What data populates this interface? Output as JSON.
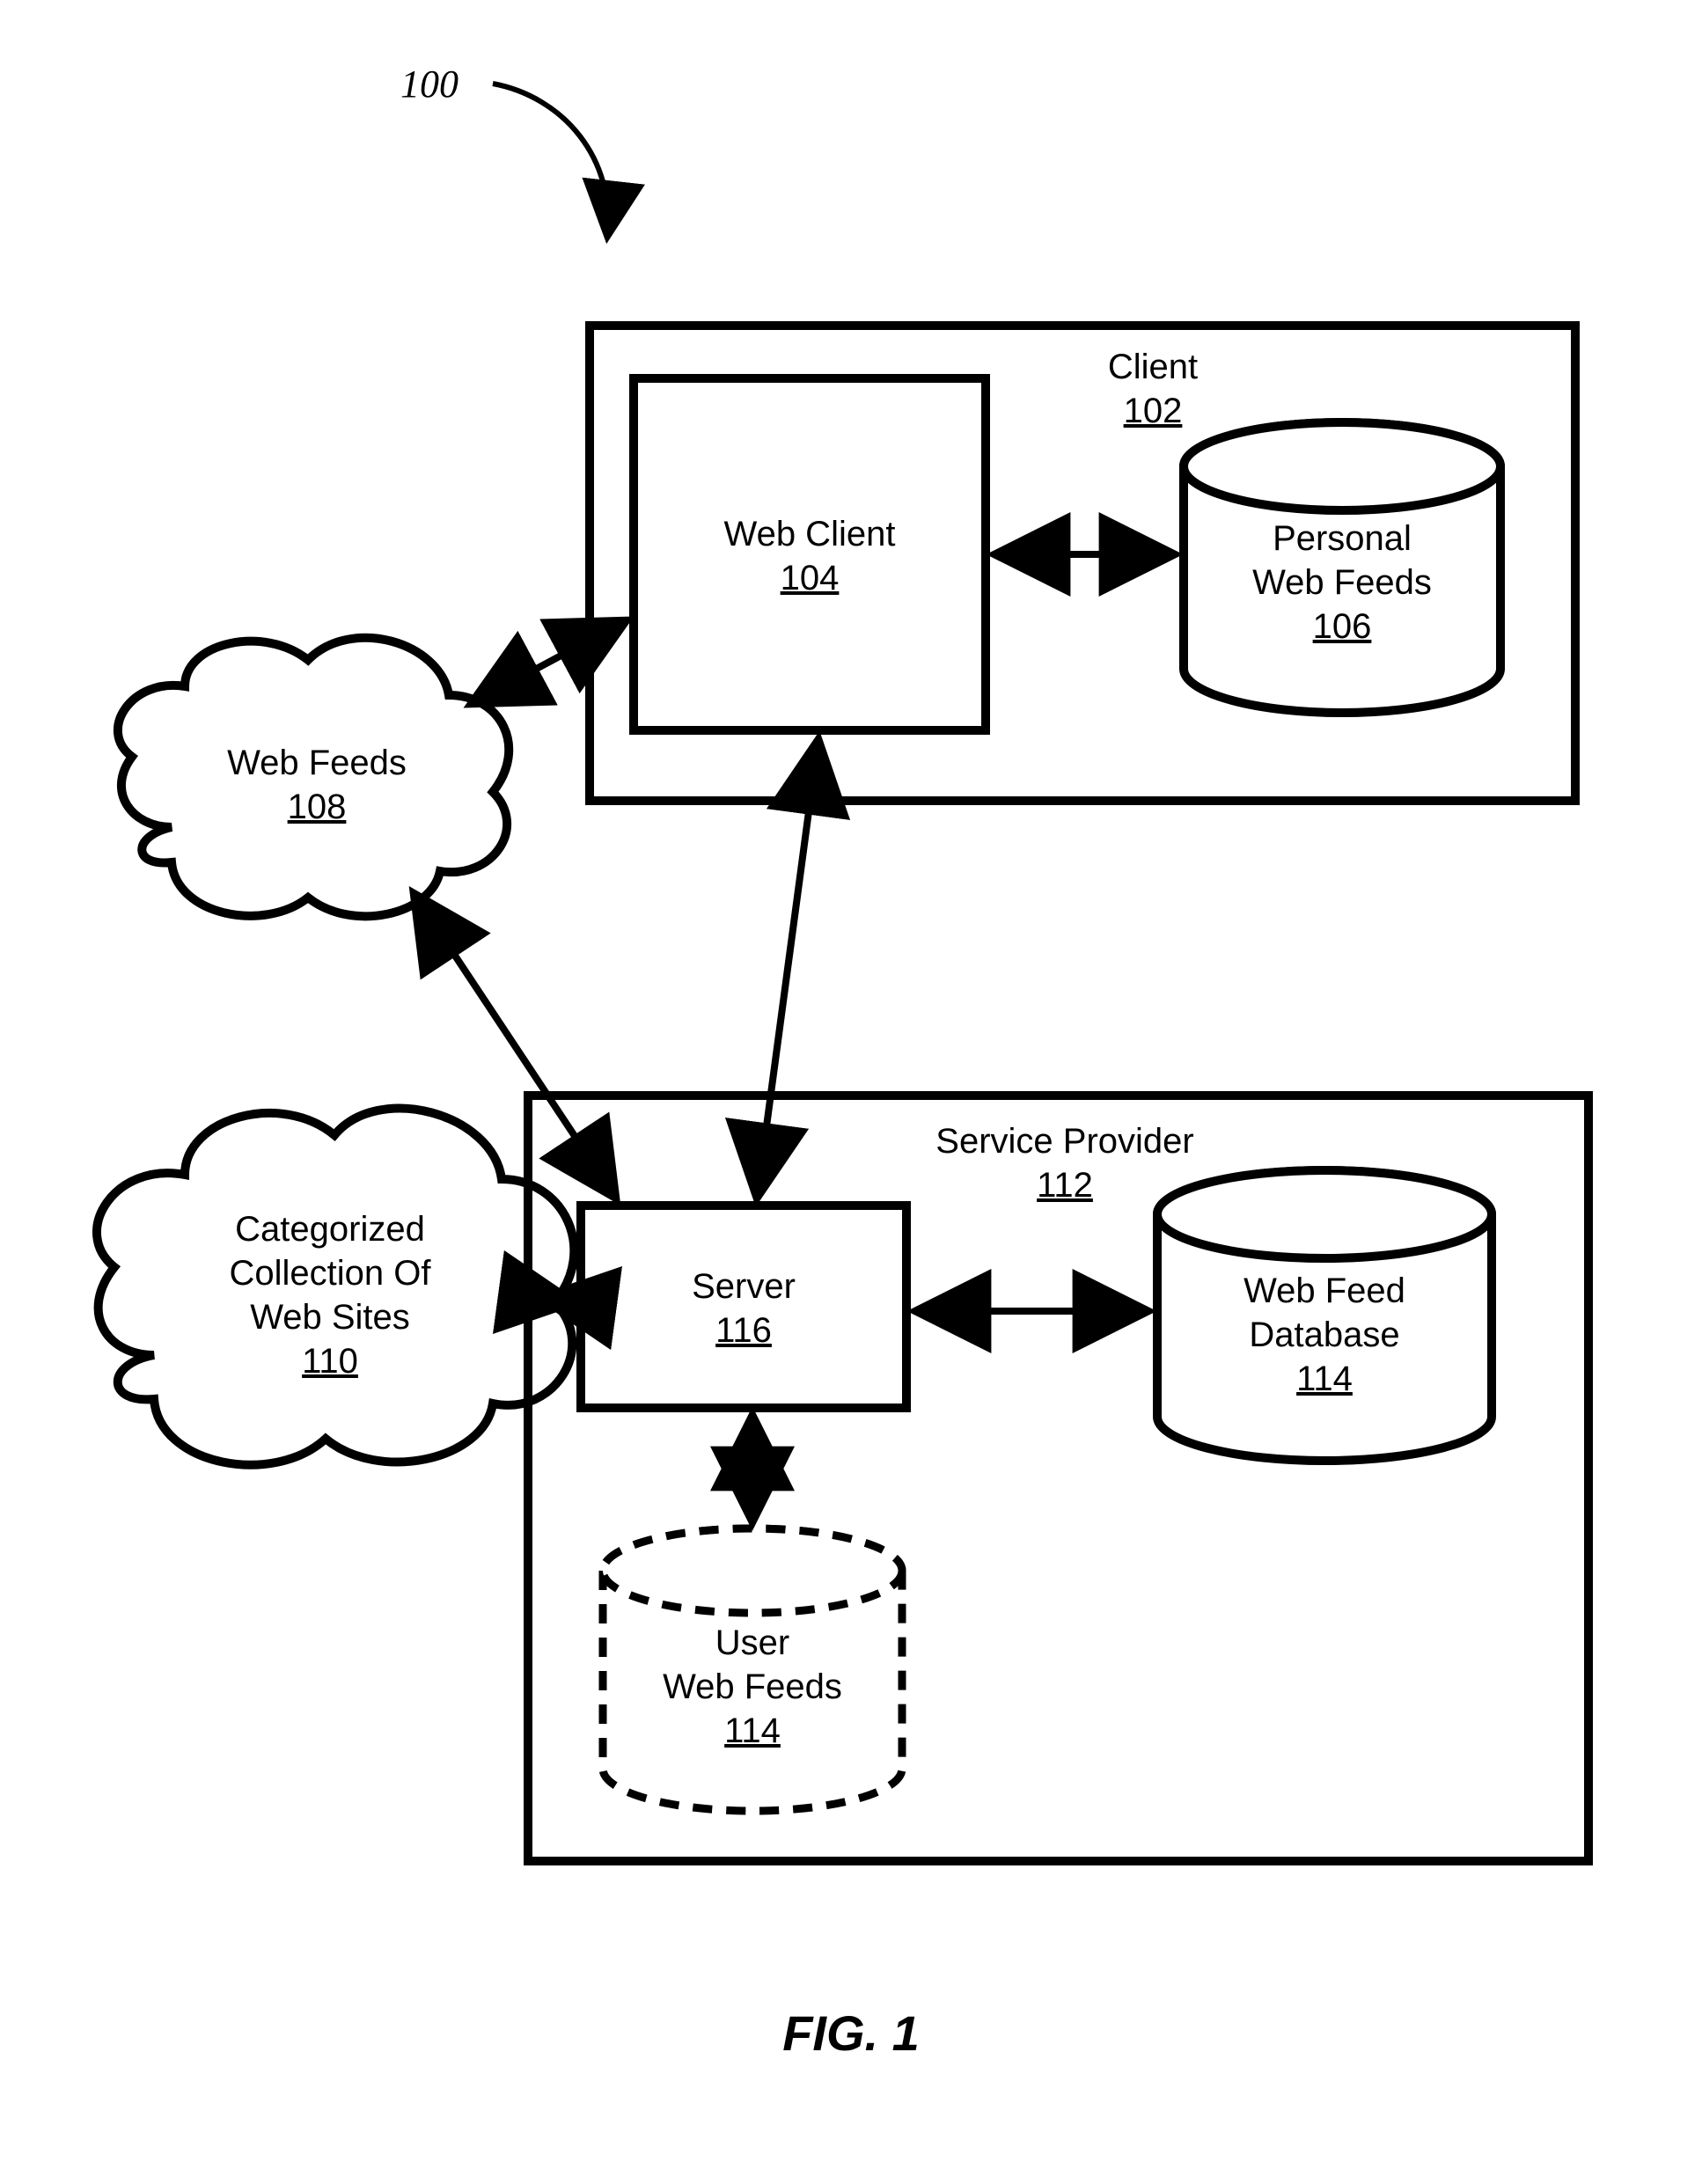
{
  "figure_ref_number": "100",
  "figure_caption": "FIG.  1",
  "client": {
    "title": "Client",
    "number": "102"
  },
  "web_client": {
    "title": "Web Client",
    "number": "104"
  },
  "personal_web_feeds": {
    "line1": "Personal",
    "line2": "Web Feeds",
    "number": "106"
  },
  "web_feeds": {
    "title": "Web Feeds",
    "number": "108"
  },
  "categorized": {
    "line1": "Categorized",
    "line2": "Collection Of",
    "line3": "Web Sites",
    "number": "110"
  },
  "service_provider": {
    "title": "Service Provider",
    "number": "112"
  },
  "server": {
    "title": "Server",
    "number": "116"
  },
  "web_feed_db": {
    "line1": "Web Feed",
    "line2": "Database",
    "number": "114"
  },
  "user_web_feeds": {
    "line1": "User",
    "line2": "Web Feeds",
    "number": "114"
  }
}
